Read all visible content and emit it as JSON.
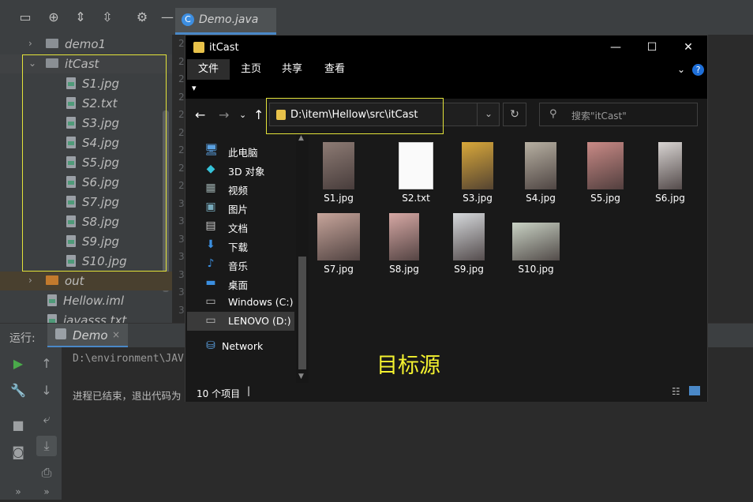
{
  "ide": {
    "editor_tab": "Demo.java",
    "editor_tab_icon": "C",
    "gutter": [
      "2",
      "2",
      "2",
      "2",
      "2",
      "2",
      "2",
      "2",
      "2",
      "3",
      "3",
      "3",
      "3",
      "3",
      "3",
      "3"
    ],
    "tree": {
      "items": [
        {
          "label": "demo1",
          "kind": "folder",
          "arrow": "›"
        },
        {
          "label": "itCast",
          "kind": "folder",
          "arrow": "⌄"
        },
        {
          "label": "S1.jpg",
          "kind": "file"
        },
        {
          "label": "S2.txt",
          "kind": "file"
        },
        {
          "label": "S3.jpg",
          "kind": "file"
        },
        {
          "label": "S4.jpg",
          "kind": "file"
        },
        {
          "label": "S5.jpg",
          "kind": "file"
        },
        {
          "label": "S6.jpg",
          "kind": "file"
        },
        {
          "label": "S7.jpg",
          "kind": "file"
        },
        {
          "label": "S8.jpg",
          "kind": "file"
        },
        {
          "label": "S9.jpg",
          "kind": "file"
        },
        {
          "label": "S10.jpg",
          "kind": "file"
        },
        {
          "label": "out",
          "kind": "folder",
          "arrow": "›"
        },
        {
          "label": "Hellow.iml",
          "kind": "file"
        },
        {
          "label": "javasss.txt",
          "kind": "file"
        }
      ]
    },
    "run": {
      "label": "运行:",
      "tab": "Demo",
      "tab_close": "×",
      "console": [
        "D:\\environment\\JAV",
        "进程已结束，退出代码为"
      ]
    },
    "colors": {
      "selection": "#e3e33a",
      "accent": "#4a88c7"
    }
  },
  "explorer": {
    "title": "itCast",
    "window_buttons": [
      "—",
      "☐",
      "✕"
    ],
    "ribbon_tabs": [
      "文件",
      "主页",
      "共享",
      "查看"
    ],
    "help": "?",
    "address": "D:\\item\\Hellow\\src\\itCast",
    "search_placeholder": "搜索\"itCast\"",
    "nav": [
      {
        "label": "此电脑",
        "icon": "computer-icon"
      },
      {
        "label": "3D 对象",
        "icon": "cube-icon"
      },
      {
        "label": "视频",
        "icon": "video-icon"
      },
      {
        "label": "图片",
        "icon": "picture-icon"
      },
      {
        "label": "文档",
        "icon": "document-icon"
      },
      {
        "label": "下载",
        "icon": "download-icon"
      },
      {
        "label": "音乐",
        "icon": "music-icon"
      },
      {
        "label": "桌面",
        "icon": "desktop-icon"
      },
      {
        "label": "Windows (C:)",
        "icon": "drive-icon"
      },
      {
        "label": "LENOVO (D:)",
        "icon": "drive-icon"
      },
      {
        "label": "Network",
        "icon": "network-icon"
      }
    ],
    "files": [
      {
        "name": "S1.jpg",
        "kind": "image",
        "color": "#8d7b74"
      },
      {
        "name": "S2.txt",
        "kind": "text",
        "color": "#ffffff"
      },
      {
        "name": "S3.jpg",
        "kind": "image",
        "color": "#d9a83a"
      },
      {
        "name": "S4.jpg",
        "kind": "image",
        "color": "#b7b0a2"
      },
      {
        "name": "S5.jpg",
        "kind": "image",
        "color": "#c98a86"
      },
      {
        "name": "S6.jpg",
        "kind": "image",
        "color": "#d8d4d2"
      },
      {
        "name": "S7.jpg",
        "kind": "image",
        "color": "#c7a59b"
      },
      {
        "name": "S8.jpg",
        "kind": "image",
        "color": "#d6a8a4"
      },
      {
        "name": "S9.jpg",
        "kind": "image",
        "color": "#d6d9dc"
      },
      {
        "name": "S10.jpg",
        "kind": "image",
        "color": "#c9d2c4"
      }
    ],
    "target_label": "目标源",
    "status": "10 个项目",
    "colors": {
      "highlight": "#e3e33a",
      "target": "#f4f22f"
    }
  }
}
